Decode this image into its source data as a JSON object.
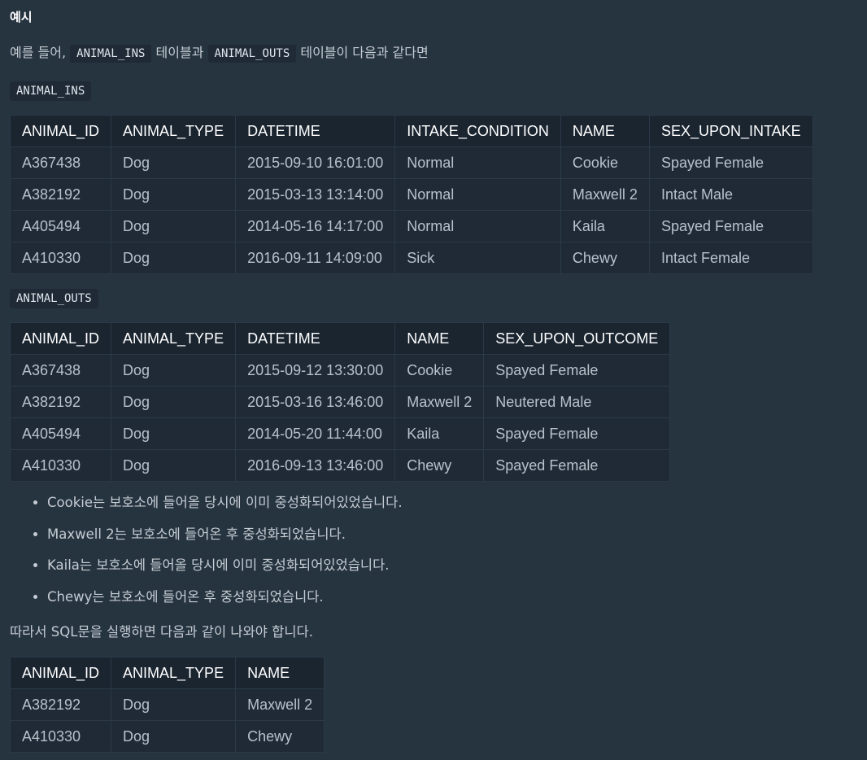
{
  "section_title": "예시",
  "intro": {
    "prefix": "예를 들어,",
    "table1_code": "ANIMAL_INS",
    "middle": "테이블과",
    "table2_code": "ANIMAL_OUTS",
    "suffix": "테이블이 다음과 같다면"
  },
  "animal_ins": {
    "label": "ANIMAL_INS",
    "columns": [
      "ANIMAL_ID",
      "ANIMAL_TYPE",
      "DATETIME",
      "INTAKE_CONDITION",
      "NAME",
      "SEX_UPON_INTAKE"
    ],
    "rows": [
      [
        "A367438",
        "Dog",
        "2015-09-10 16:01:00",
        "Normal",
        "Cookie",
        "Spayed Female"
      ],
      [
        "A382192",
        "Dog",
        "2015-03-13 13:14:00",
        "Normal",
        "Maxwell 2",
        "Intact Male"
      ],
      [
        "A405494",
        "Dog",
        "2014-05-16 14:17:00",
        "Normal",
        "Kaila",
        "Spayed Female"
      ],
      [
        "A410330",
        "Dog",
        "2016-09-11 14:09:00",
        "Sick",
        "Chewy",
        "Intact Female"
      ]
    ]
  },
  "animal_outs": {
    "label": "ANIMAL_OUTS",
    "columns": [
      "ANIMAL_ID",
      "ANIMAL_TYPE",
      "DATETIME",
      "NAME",
      "SEX_UPON_OUTCOME"
    ],
    "rows": [
      [
        "A367438",
        "Dog",
        "2015-09-12 13:30:00",
        "Cookie",
        "Spayed Female"
      ],
      [
        "A382192",
        "Dog",
        "2015-03-16 13:46:00",
        "Maxwell 2",
        "Neutered Male"
      ],
      [
        "A405494",
        "Dog",
        "2014-05-20 11:44:00",
        "Kaila",
        "Spayed Female"
      ],
      [
        "A410330",
        "Dog",
        "2016-09-13 13:46:00",
        "Chewy",
        "Spayed Female"
      ]
    ]
  },
  "notes": [
    "Cookie는 보호소에 들어올 당시에 이미 중성화되어있었습니다.",
    "Maxwell 2는 보호소에 들어온 후 중성화되었습니다.",
    "Kaila는 보호소에 들어올 당시에 이미 중성화되어있었습니다.",
    "Chewy는 보호소에 들어온 후 중성화되었습니다."
  ],
  "conclusion": "따라서 SQL문을 실행하면 다음과 같이 나와야 합니다.",
  "result": {
    "columns": [
      "ANIMAL_ID",
      "ANIMAL_TYPE",
      "NAME"
    ],
    "rows": [
      [
        "A382192",
        "Dog",
        "Maxwell 2"
      ],
      [
        "A410330",
        "Dog",
        "Chewy"
      ]
    ]
  }
}
